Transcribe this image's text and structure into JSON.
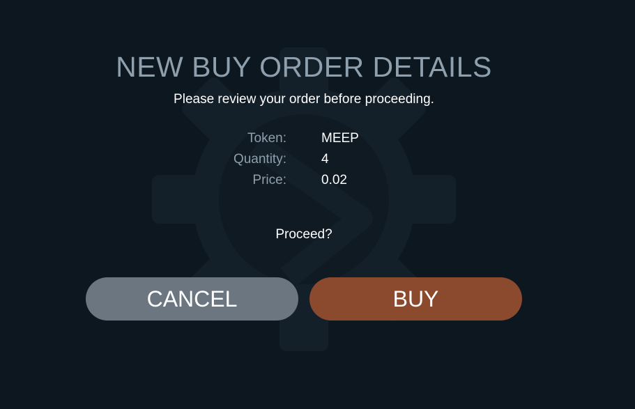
{
  "dialog": {
    "title": "NEW BUY ORDER DETAILS",
    "subtitle": "Please review your order before proceeding.",
    "details": [
      {
        "label": "Token:",
        "value": "MEEP"
      },
      {
        "label": "Quantity:",
        "value": "4"
      },
      {
        "label": "Price:",
        "value": "0.02"
      }
    ],
    "proceed_text": "Proceed?",
    "cancel_label": "CANCEL",
    "buy_label": "BUY"
  },
  "colors": {
    "background": "#0d1720",
    "title": "#8e9fad",
    "label": "#8e9fad",
    "value": "#ffffff",
    "cancel_button": "#6b7680",
    "buy_button": "#8b4a2e",
    "watermark": "#131f29"
  },
  "icons": {
    "watermark": "gear-logo-icon"
  }
}
